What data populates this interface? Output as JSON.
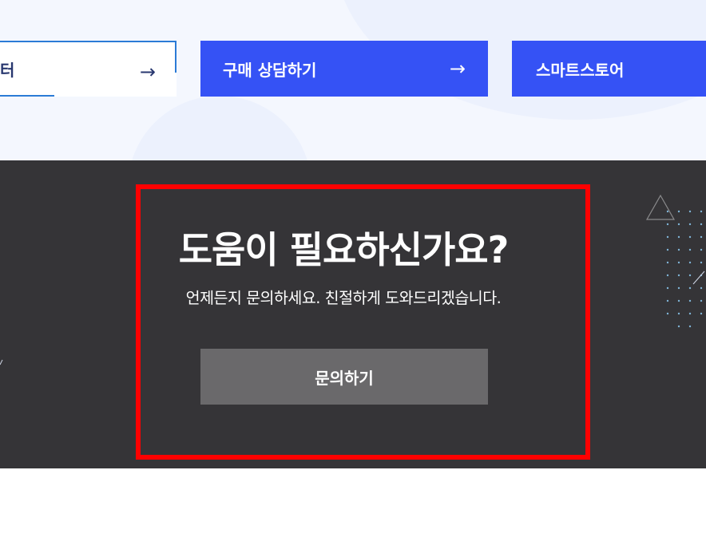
{
  "cta_buttons": [
    {
      "label": "터",
      "arrow": "→"
    },
    {
      "label": "구매 상담하기",
      "arrow": "→"
    },
    {
      "label": "스마트스토어"
    }
  ],
  "help": {
    "title": "도움이 필요하신가요?",
    "description": "언제든지 문의하세요. 친절하게 도와드리겠습니다.",
    "button_label": "문의하기"
  },
  "colors": {
    "primary_blue": "#3552f5",
    "dark_background": "#353437",
    "highlight_red": "#ff0000",
    "button_gray": "#6a696b",
    "light_background": "#f4f7fe"
  },
  "icons": {
    "cta_arrow": "arrow-right-icon",
    "decoration": [
      "triangle-outline-icon",
      "dot-grid-icon"
    ]
  }
}
